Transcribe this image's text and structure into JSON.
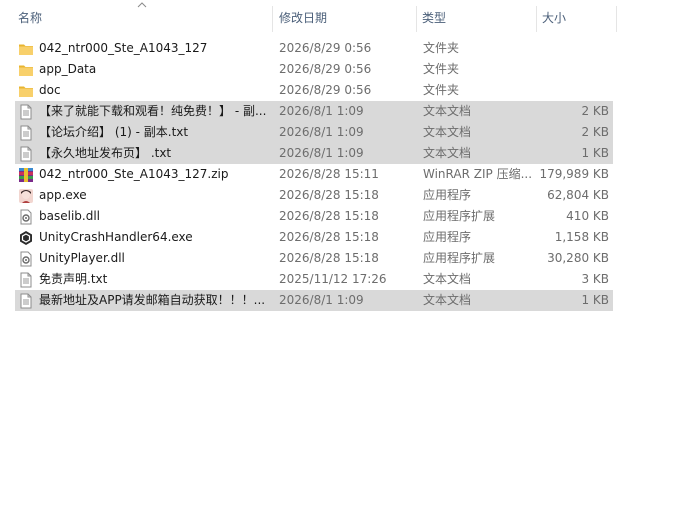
{
  "columns": {
    "name": "名称",
    "date": "修改日期",
    "type": "类型",
    "size": "大小"
  },
  "sort": {
    "column": "name",
    "direction": "ascending",
    "icon": "sort-up-icon"
  },
  "files": [
    {
      "name": "042_ntr000_Ste_A1043_127",
      "date": "2026/8/29 0:56",
      "type": "文件夹",
      "size": "",
      "icon": "folder-icon",
      "selected": false
    },
    {
      "name": "app_Data",
      "date": "2026/8/29 0:56",
      "type": "文件夹",
      "size": "",
      "icon": "folder-icon",
      "selected": false
    },
    {
      "name": "doc",
      "date": "2026/8/29 0:56",
      "type": "文件夹",
      "size": "",
      "icon": "folder-icon",
      "selected": false
    },
    {
      "name": "【来了就能下载和观看！纯免费！】 - 副...",
      "date": "2026/8/1 1:09",
      "type": "文本文档",
      "size": "2 KB",
      "icon": "text-file-icon",
      "selected": true
    },
    {
      "name": "【论坛介绍】 (1) - 副本.txt",
      "date": "2026/8/1 1:09",
      "type": "文本文档",
      "size": "2 KB",
      "icon": "text-file-icon",
      "selected": true
    },
    {
      "name": "【永久地址发布页】 .txt",
      "date": "2026/8/1 1:09",
      "type": "文本文档",
      "size": "1 KB",
      "icon": "text-file-icon",
      "selected": true
    },
    {
      "name": "042_ntr000_Ste_A1043_127.zip",
      "date": "2026/8/28 15:11",
      "type": "WinRAR ZIP 压缩...",
      "size": "179,989 KB",
      "icon": "winrar-archive-icon",
      "selected": false
    },
    {
      "name": "app.exe",
      "date": "2026/8/28 15:18",
      "type": "应用程序",
      "size": "62,804 KB",
      "icon": "app-exe-icon",
      "selected": false
    },
    {
      "name": "baselib.dll",
      "date": "2026/8/28 15:18",
      "type": "应用程序扩展",
      "size": "410 KB",
      "icon": "dll-file-icon",
      "selected": false
    },
    {
      "name": "UnityCrashHandler64.exe",
      "date": "2026/8/28 15:18",
      "type": "应用程序",
      "size": "1,158 KB",
      "icon": "unity-icon",
      "selected": false
    },
    {
      "name": "UnityPlayer.dll",
      "date": "2026/8/28 15:18",
      "type": "应用程序扩展",
      "size": "30,280 KB",
      "icon": "dll-file-icon",
      "selected": false
    },
    {
      "name": "免责声明.txt",
      "date": "2025/11/12 17:26",
      "type": "文本文档",
      "size": "3 KB",
      "icon": "text-file-icon",
      "selected": false
    },
    {
      "name": "最新地址及APP请发邮箱自动获取！！！...",
      "date": "2026/8/1 1:09",
      "type": "文本文档",
      "size": "1 KB",
      "icon": "text-file-icon",
      "selected": true
    }
  ],
  "colors": {
    "selection": "#d9d9d9",
    "header_text": "#4c607a",
    "folder": "#f5c542",
    "secondary_text": "#6d6d6d"
  }
}
